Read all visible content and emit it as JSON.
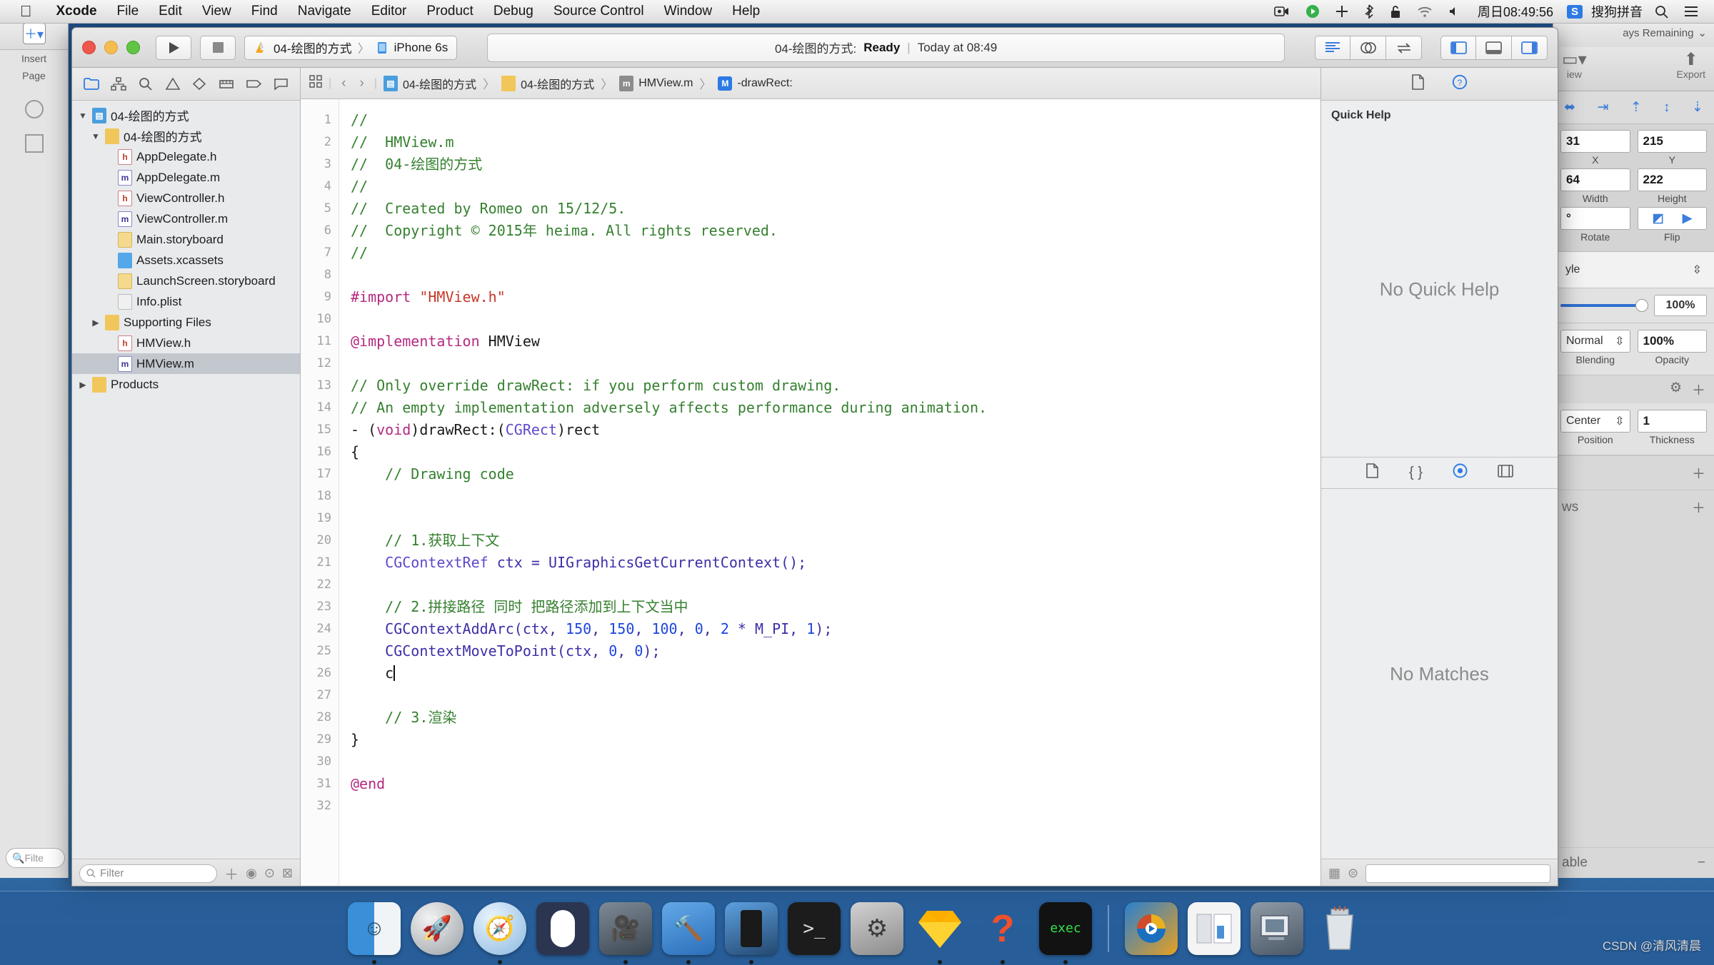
{
  "menubar": {
    "apple_icon": "apple-icon",
    "items": [
      {
        "label": "Xcode",
        "bold": true
      },
      {
        "label": "File",
        "bold": false
      },
      {
        "label": "Edit",
        "bold": false
      },
      {
        "label": "View",
        "bold": false
      },
      {
        "label": "Find",
        "bold": false
      },
      {
        "label": "Navigate",
        "bold": false
      },
      {
        "label": "Editor",
        "bold": false
      },
      {
        "label": "Product",
        "bold": false
      },
      {
        "label": "Debug",
        "bold": false
      },
      {
        "label": "Source Control",
        "bold": false
      },
      {
        "label": "Window",
        "bold": false
      },
      {
        "label": "Help",
        "bold": false
      }
    ],
    "status_icons": [
      "screen-recording-icon",
      "play-circle-icon",
      "plus-icon",
      "bluetooth-icon",
      "lock-icon",
      "wifi-icon",
      "volume-icon"
    ],
    "clock": "周日08:49:56",
    "input_method_badge": "S",
    "input_method": "搜狗拼音",
    "search_icon": "search-icon",
    "notification_icon": "notification-list-icon"
  },
  "xcode": {
    "toolbar": {
      "run_icon": "play-icon",
      "stop_icon": "stop-icon",
      "scheme_name": "04-绘图的方式",
      "scheme_separator": "〉",
      "destination": "iPhone 6s",
      "status_project": "04-绘图的方式:",
      "status_state": "Ready",
      "status_bar_sep": "|",
      "status_time": "Today at 08:49",
      "editor_buttons": [
        "standard-editor-icon",
        "assistant-editor-icon",
        "version-editor-icon"
      ],
      "view_buttons": [
        "toggle-navigator-icon",
        "toggle-debug-area-icon",
        "toggle-utilities-icon"
      ]
    },
    "navigator": {
      "tabs": [
        "project-navigator-icon",
        "symbol-navigator-icon",
        "find-navigator-icon",
        "issue-navigator-icon",
        "test-navigator-icon",
        "debug-navigator-icon",
        "breakpoint-navigator-icon",
        "report-navigator-icon"
      ],
      "active_tab_index": 0,
      "tree": [
        {
          "label": "04-绘图的方式",
          "indent": 0,
          "twisty": "▼",
          "icon": "project",
          "selected": false
        },
        {
          "label": "04-绘图的方式",
          "indent": 1,
          "twisty": "▼",
          "icon": "folder",
          "selected": false
        },
        {
          "label": "AppDelegate.h",
          "indent": 2,
          "twisty": "",
          "icon": "h",
          "selected": false
        },
        {
          "label": "AppDelegate.m",
          "indent": 2,
          "twisty": "",
          "icon": "m",
          "selected": false
        },
        {
          "label": "ViewController.h",
          "indent": 2,
          "twisty": "",
          "icon": "h",
          "selected": false
        },
        {
          "label": "ViewController.m",
          "indent": 2,
          "twisty": "",
          "icon": "m",
          "selected": false
        },
        {
          "label": "Main.storyboard",
          "indent": 2,
          "twisty": "",
          "icon": "sb",
          "selected": false
        },
        {
          "label": "Assets.xcassets",
          "indent": 2,
          "twisty": "",
          "icon": "xc",
          "selected": false
        },
        {
          "label": "LaunchScreen.storyboard",
          "indent": 2,
          "twisty": "",
          "icon": "sb",
          "selected": false
        },
        {
          "label": "Info.plist",
          "indent": 2,
          "twisty": "",
          "icon": "pl",
          "selected": false
        },
        {
          "label": "Supporting Files",
          "indent": 1,
          "twisty": "▶",
          "icon": "folder",
          "selected": false
        },
        {
          "label": "HMView.h",
          "indent": 2,
          "twisty": "",
          "icon": "h",
          "selected": false
        },
        {
          "label": "HMView.m",
          "indent": 2,
          "twisty": "",
          "icon": "m",
          "selected": true
        },
        {
          "label": "Products",
          "indent": 0,
          "twisty": "▶",
          "icon": "folder",
          "selected": false
        }
      ],
      "filter_placeholder": "Filter",
      "add_icon": "add-file-icon",
      "filter_icon": "filter-recent-icon",
      "source_control_icon": "source-control-filter-icon",
      "nested_icon": "nested-filter-icon"
    },
    "jumpbar": {
      "related_icon": "related-items-icon",
      "back_icon": "back-chevron-icon",
      "forward_icon": "forward-chevron-icon",
      "crumbs": [
        {
          "label": "04-绘图的方式",
          "icon": "project"
        },
        {
          "label": "04-绘图的方式",
          "icon": "folder"
        },
        {
          "label": "HMView.m",
          "icon": "m"
        },
        {
          "label": "-drawRect:",
          "icon": "method"
        }
      ]
    },
    "code": {
      "first_line": 1,
      "last_line": 32,
      "lines": [
        {
          "n": 1,
          "tokens": [
            {
              "t": "//",
              "c": "cm"
            }
          ]
        },
        {
          "n": 2,
          "tokens": [
            {
              "t": "//  HMView.m",
              "c": "cm"
            }
          ]
        },
        {
          "n": 3,
          "tokens": [
            {
              "t": "//  04-绘图的方式",
              "c": "cm"
            }
          ]
        },
        {
          "n": 4,
          "tokens": [
            {
              "t": "//",
              "c": "cm"
            }
          ]
        },
        {
          "n": 5,
          "tokens": [
            {
              "t": "//  Created by Romeo on 15/12/5.",
              "c": "cm"
            }
          ]
        },
        {
          "n": 6,
          "tokens": [
            {
              "t": "//  Copyright © 2015年 heima. All rights reserved.",
              "c": "cm"
            }
          ]
        },
        {
          "n": 7,
          "tokens": [
            {
              "t": "//",
              "c": "cm"
            }
          ]
        },
        {
          "n": 8,
          "tokens": []
        },
        {
          "n": 9,
          "tokens": [
            {
              "t": "#import ",
              "c": "pp"
            },
            {
              "t": "\"HMView.h\"",
              "c": "str"
            }
          ]
        },
        {
          "n": 10,
          "tokens": []
        },
        {
          "n": 11,
          "tokens": [
            {
              "t": "@implementation",
              "c": "kw"
            },
            {
              "t": " HMView",
              "c": ""
            }
          ]
        },
        {
          "n": 12,
          "tokens": []
        },
        {
          "n": 13,
          "tokens": [
            {
              "t": "// Only override drawRect: if you perform custom drawing.",
              "c": "cm"
            }
          ]
        },
        {
          "n": 14,
          "tokens": [
            {
              "t": "// An empty implementation adversely affects performance during animation.",
              "c": "cm"
            }
          ]
        },
        {
          "n": 15,
          "tokens": [
            {
              "t": "- (",
              "c": ""
            },
            {
              "t": "void",
              "c": "kw"
            },
            {
              "t": ")drawRect:(",
              "c": ""
            },
            {
              "t": "CGRect",
              "c": "ty"
            },
            {
              "t": ")rect",
              "c": ""
            }
          ]
        },
        {
          "n": 16,
          "tokens": [
            {
              "t": "{",
              "c": ""
            }
          ]
        },
        {
          "n": 17,
          "tokens": [
            {
              "t": "    // Drawing code",
              "c": "cm"
            }
          ]
        },
        {
          "n": 18,
          "tokens": []
        },
        {
          "n": 19,
          "tokens": []
        },
        {
          "n": 20,
          "tokens": [
            {
              "t": "    // 1.获取上下文",
              "c": "cm"
            }
          ]
        },
        {
          "n": 21,
          "tokens": [
            {
              "t": "    ",
              "c": ""
            },
            {
              "t": "CGContextRef",
              "c": "ty"
            },
            {
              "t": " ctx = UIGraphicsGetCurrentContext();",
              "c": "fn"
            }
          ]
        },
        {
          "n": 22,
          "tokens": []
        },
        {
          "n": 23,
          "tokens": [
            {
              "t": "    // 2.拼接路径 同时 把路径添加到上下文当中",
              "c": "cm"
            }
          ]
        },
        {
          "n": 24,
          "tokens": [
            {
              "t": "    CGContextAddArc(ctx, ",
              "c": "fn"
            },
            {
              "t": "150",
              "c": "num"
            },
            {
              "t": ", ",
              "c": "fn"
            },
            {
              "t": "150",
              "c": "num"
            },
            {
              "t": ", ",
              "c": "fn"
            },
            {
              "t": "100",
              "c": "num"
            },
            {
              "t": ", ",
              "c": "fn"
            },
            {
              "t": "0",
              "c": "num"
            },
            {
              "t": ", ",
              "c": "fn"
            },
            {
              "t": "2",
              "c": "num"
            },
            {
              "t": " * M_PI, ",
              "c": "fn"
            },
            {
              "t": "1",
              "c": "num"
            },
            {
              "t": ");",
              "c": "fn"
            }
          ]
        },
        {
          "n": 25,
          "tokens": [
            {
              "t": "    CGContextMoveToPoint(ctx, ",
              "c": "fn"
            },
            {
              "t": "0",
              "c": "num"
            },
            {
              "t": ", ",
              "c": "fn"
            },
            {
              "t": "0",
              "c": "num"
            },
            {
              "t": ");",
              "c": "fn"
            }
          ]
        },
        {
          "n": 26,
          "tokens": [
            {
              "t": "    c",
              "c": ""
            },
            {
              "t": "|caret|",
              "c": "caret"
            }
          ]
        },
        {
          "n": 27,
          "tokens": []
        },
        {
          "n": 28,
          "tokens": [
            {
              "t": "    // 3.渲染",
              "c": "cm"
            }
          ]
        },
        {
          "n": 29,
          "tokens": [
            {
              "t": "}",
              "c": ""
            }
          ]
        },
        {
          "n": 30,
          "tokens": []
        },
        {
          "n": 31,
          "tokens": [
            {
              "t": "@end",
              "c": "kw"
            }
          ]
        },
        {
          "n": 32,
          "tokens": []
        }
      ]
    },
    "utilities": {
      "tabs": [
        "file-inspector-icon",
        "quick-help-inspector-icon"
      ],
      "active_tab_index": 1,
      "quick_help_title": "Quick Help",
      "quick_help_body": "No Quick Help",
      "library_tabs": [
        "file-template-library-icon",
        "code-snippet-library-icon",
        "object-library-icon",
        "media-library-icon"
      ],
      "library_active_index": 2,
      "library_body": "No Matches",
      "library_filter_placeholder": "",
      "library_grid_icon": "grid-view-icon",
      "library_list_icon": "list-view-icon"
    }
  },
  "background_app_right": {
    "title_suffix": "ays Remaining",
    "chevron": "⌄",
    "view_label": "iew",
    "export_label": "Export",
    "align_icons": [
      "align-horizontal-icon",
      "align-right-icon",
      "align-top-icon",
      "align-middle-icon",
      "align-bottom-icon"
    ],
    "x_value": "31",
    "x_label": "X",
    "y_value": "215",
    "y_label": "Y",
    "width_value": "64",
    "width_label": "Width",
    "height_value": "222",
    "height_label": "Height",
    "lock_icon": "link-lock-icon",
    "rotate_value": "°",
    "rotate_label": "Rotate",
    "flip_label": "Flip",
    "flip_icons": [
      "flip-horizontal-icon",
      "flip-vertical-icon"
    ],
    "style_label": "yle",
    "opacity_slider_value": "100%",
    "blending_value": "Normal",
    "blending_label": "Blending",
    "opacity_value": "100%",
    "opacity_label": "Opacity",
    "gear_icon": "gear-icon",
    "plus_icon": "plus-icon",
    "position_value": "Center",
    "position_label": "Position",
    "thickness_value": "1",
    "thickness_label": "Thickness",
    "shadows_label": "ws",
    "table_label": "able"
  },
  "background_app_left": {
    "insert_label": "Insert",
    "page_label": "Page",
    "add_icon": "add-shape-icon",
    "filter_placeholder": "Filte"
  },
  "dock": {
    "items": [
      {
        "name": "finder-dock-icon",
        "running": true
      },
      {
        "name": "launchpad-dock-icon",
        "running": false
      },
      {
        "name": "safari-dock-icon",
        "running": true
      },
      {
        "name": "mouse-app-dock-icon",
        "running": false
      },
      {
        "name": "quicktime-dock-icon",
        "running": true
      },
      {
        "name": "xcode-dock-icon",
        "running": true
      },
      {
        "name": "xcode-beta-dock-icon",
        "running": true
      },
      {
        "name": "terminal-dock-icon",
        "running": false
      },
      {
        "name": "system-preferences-dock-icon",
        "running": false
      },
      {
        "name": "sketch-dock-icon",
        "running": true
      },
      {
        "name": "paw-dock-icon",
        "running": true
      },
      {
        "name": "iterm-dock-icon",
        "running": true
      }
    ],
    "recent_items": [
      {
        "name": "media-player-dock-icon"
      },
      {
        "name": "keynote-dock-icon"
      },
      {
        "name": "screenflow-dock-icon"
      }
    ],
    "trash": {
      "name": "trash-dock-icon"
    }
  },
  "watermark": "CSDN @清风清晨"
}
